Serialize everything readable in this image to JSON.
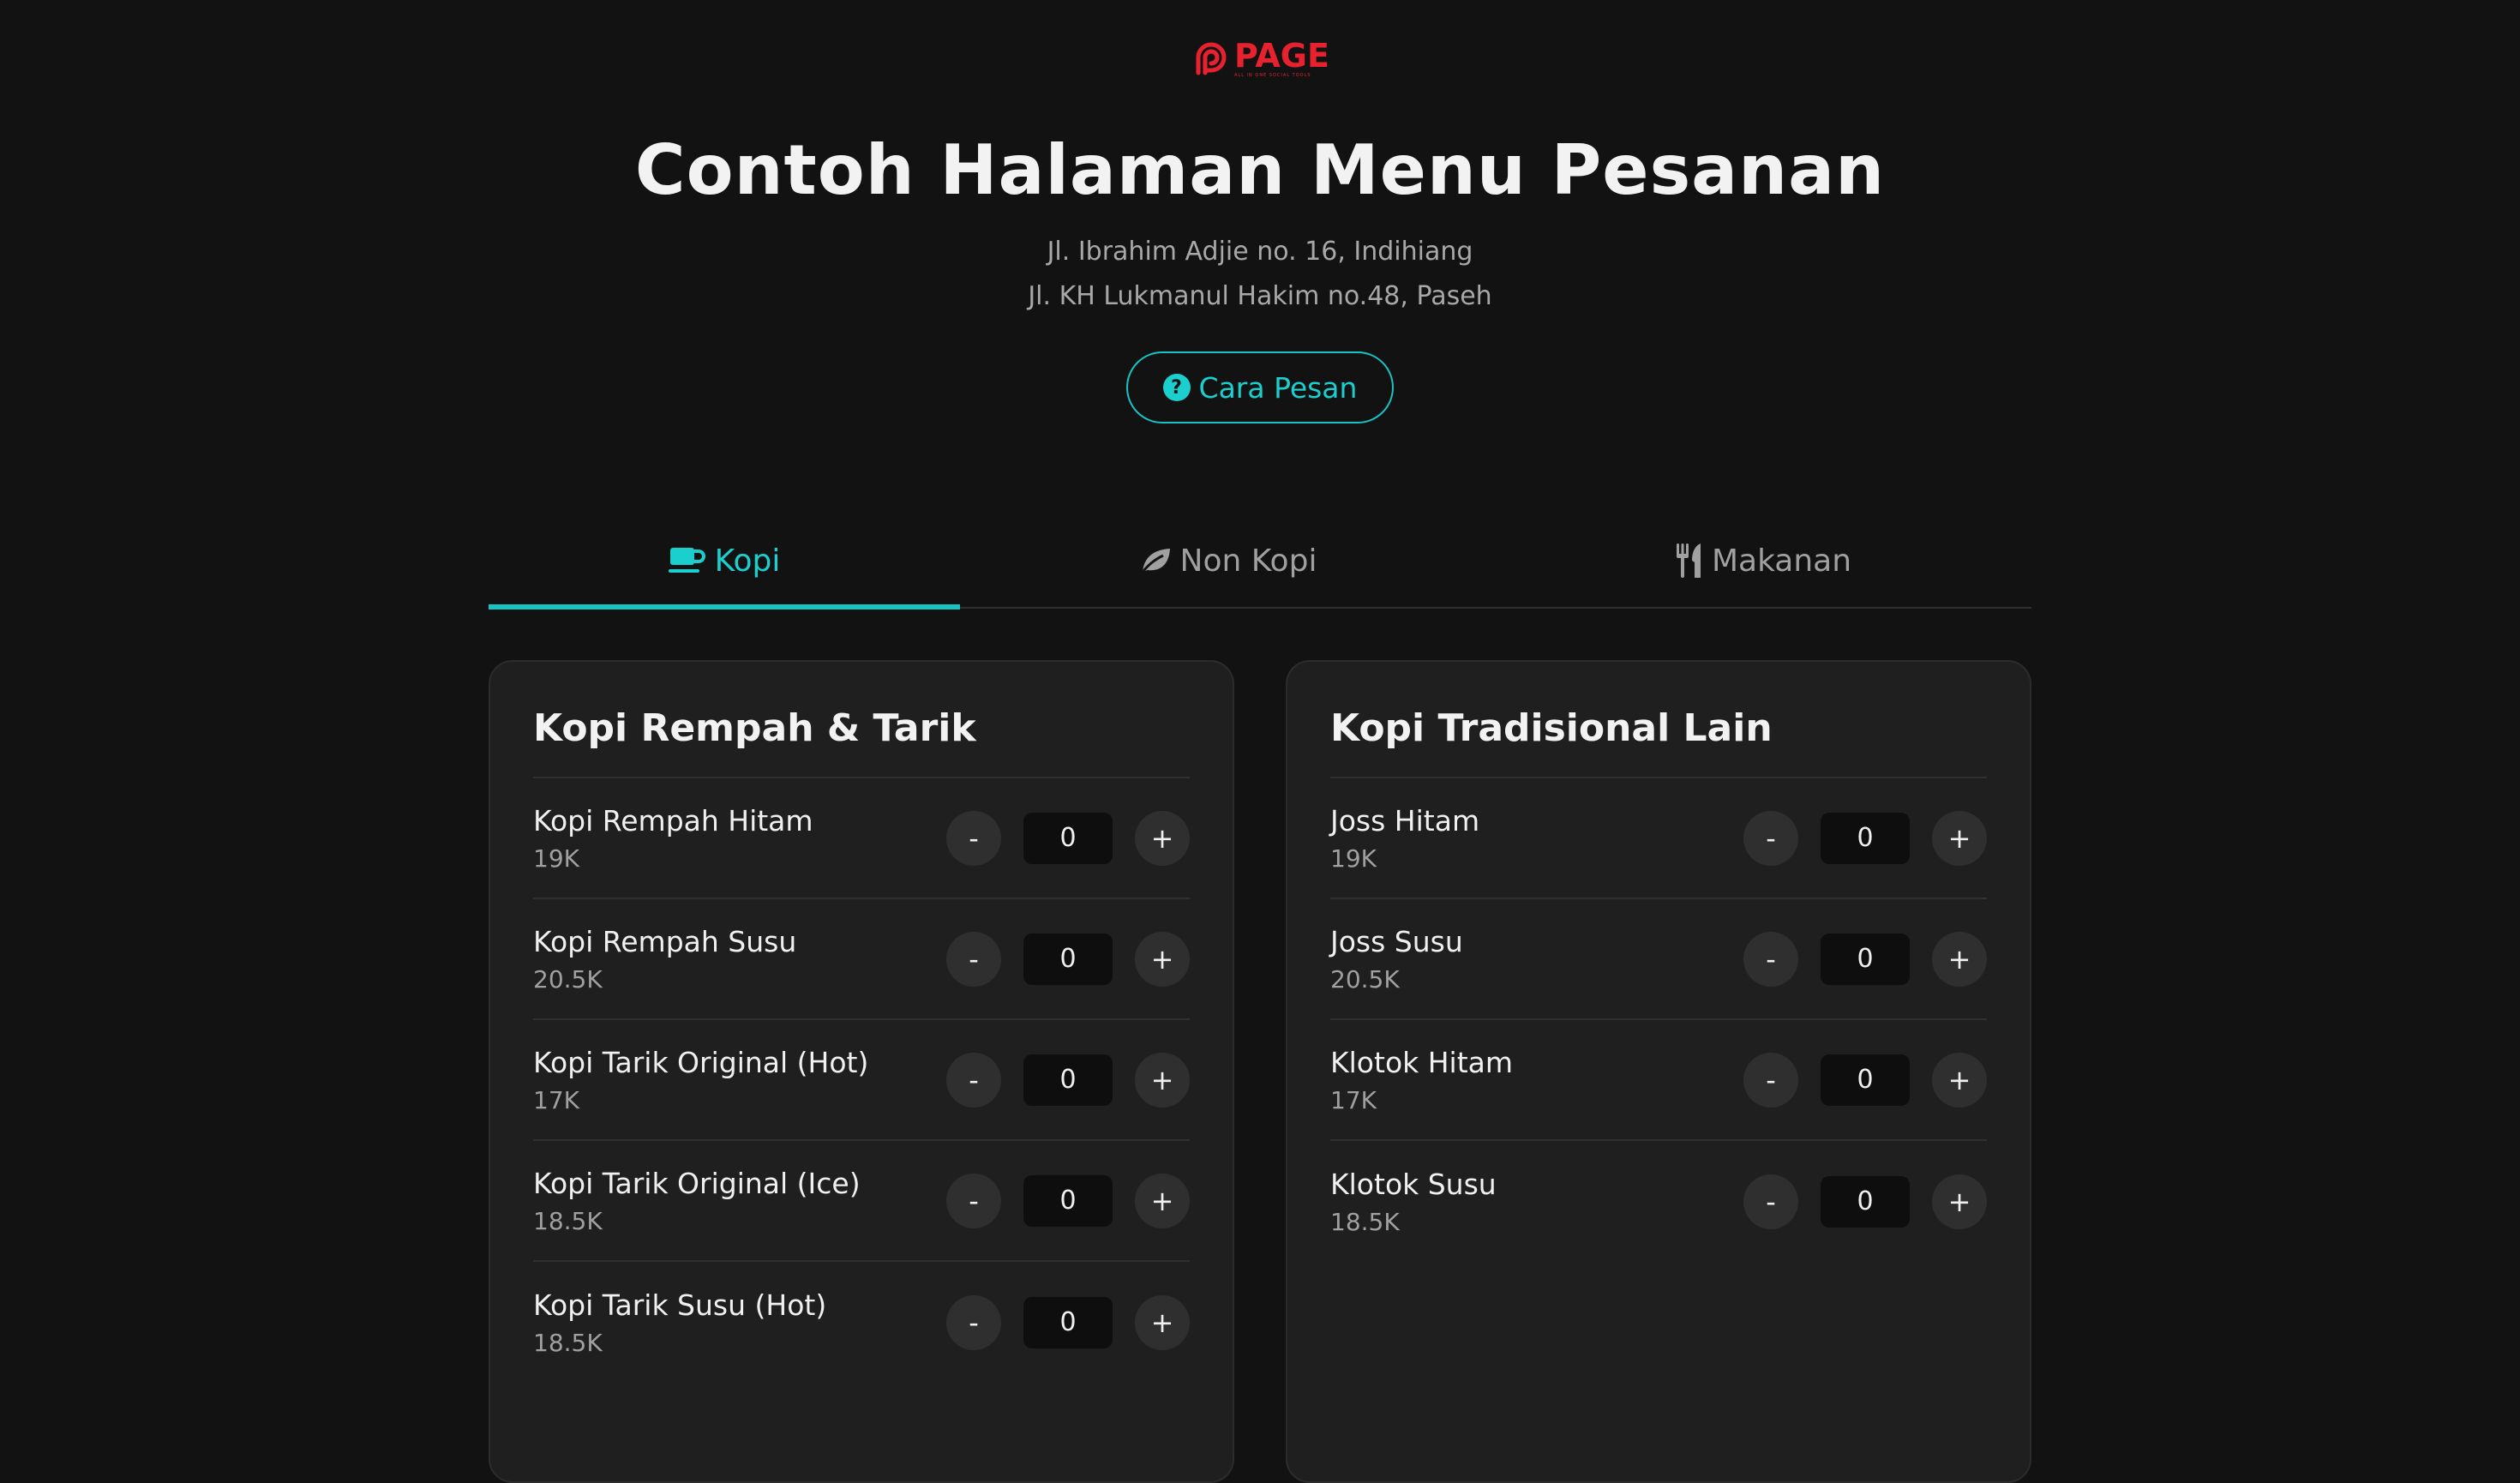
{
  "logo": {
    "word": "PAGE",
    "tagline": "ALL IN ONE SOCIAL TOOLS",
    "color": "#e8212f"
  },
  "header": {
    "title": "Contoh Halaman Menu Pesanan",
    "address_1": "Jl. Ibrahim Adjie no. 16, Indihiang",
    "address_2": "Jl. KH Lukmanul Hakim no.48, Paseh",
    "help_button": {
      "label": "Cara Pesan",
      "icon": "question-circle-icon"
    }
  },
  "accent_color": "#1ccfcf",
  "tabs": [
    {
      "label": "Kopi",
      "icon": "coffee-cup-icon",
      "active": true
    },
    {
      "label": "Non Kopi",
      "icon": "leaf-icon",
      "active": false
    },
    {
      "label": "Makanan",
      "icon": "utensils-icon",
      "active": false
    }
  ],
  "sections": [
    {
      "title": "Kopi Rempah & Tarik",
      "items": [
        {
          "name": "Kopi Rempah Hitam",
          "price": "19K",
          "qty": "0"
        },
        {
          "name": "Kopi Rempah Susu",
          "price": "20.5K",
          "qty": "0"
        },
        {
          "name": "Kopi Tarik Original (Hot)",
          "price": "17K",
          "qty": "0"
        },
        {
          "name": "Kopi Tarik Original (Ice)",
          "price": "18.5K",
          "qty": "0"
        },
        {
          "name": "Kopi Tarik Susu (Hot)",
          "price": "18.5K",
          "qty": "0"
        }
      ]
    },
    {
      "title": "Kopi Tradisional Lain",
      "items": [
        {
          "name": "Joss Hitam",
          "price": "19K",
          "qty": "0"
        },
        {
          "name": "Joss Susu",
          "price": "20.5K",
          "qty": "0"
        },
        {
          "name": "Klotok Hitam",
          "price": "17K",
          "qty": "0"
        },
        {
          "name": "Klotok Susu",
          "price": "18.5K",
          "qty": "0"
        }
      ]
    }
  ],
  "stepper": {
    "minus_label": "-",
    "plus_label": "+"
  }
}
